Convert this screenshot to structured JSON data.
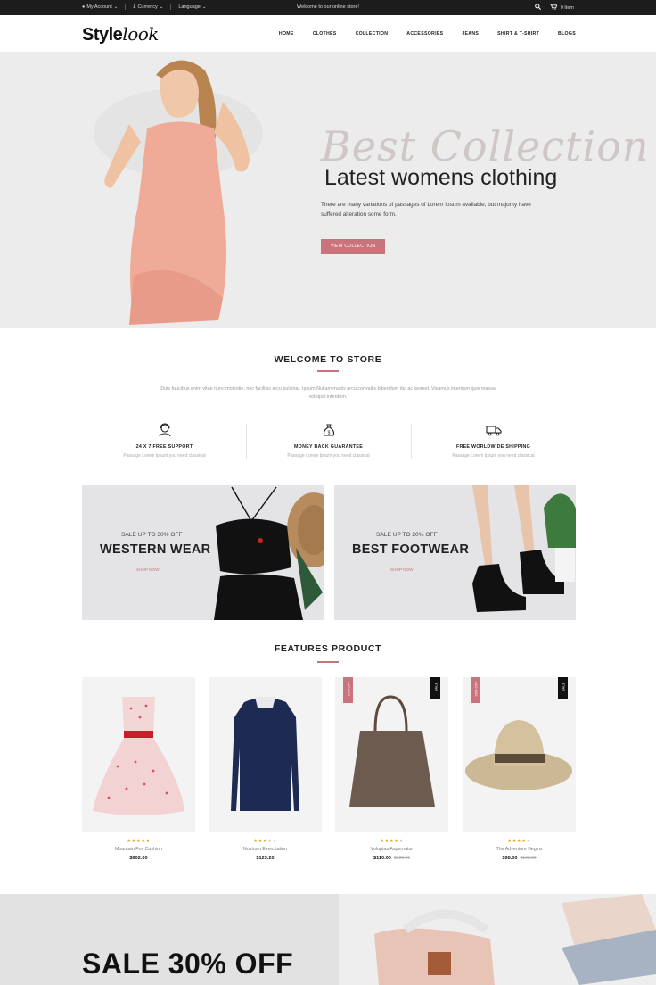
{
  "topbar": {
    "account": "My Account",
    "currency": "Currency",
    "language": "Language",
    "welcome": "Welcome to our online store!",
    "cart": "0 Item"
  },
  "header": {
    "logo_part1": "Style",
    "logo_part2": "look",
    "nav": [
      "HOME",
      "CLOTHES",
      "COLLECTION",
      "ACCESSORIES",
      "JEANS",
      "SHIRT & T-SHIRT",
      "BLOGS"
    ]
  },
  "hero": {
    "script_title": "Best Collection",
    "title": "Latest womens clothing",
    "description": "There are many variations of passages of Lorem Ipsum available, but majority have suffered alteration some form.",
    "button": "VIEW COLLECTION"
  },
  "welcome": {
    "title": "WELCOME TO STORE",
    "text": "Duis faucibus enim vitae nunc molestie, nec facilisis arcu pulvinar. Ipsum Nullam mattis arcu convallis bibendum dui ac laoreet. Vivamus interdum quis massa volutpat interdum."
  },
  "features": [
    {
      "title": "24 X 7 FREE SUPPORT",
      "subtitle": "Passage Lorem Ipsum you need classical",
      "icon": "support-agent-icon"
    },
    {
      "title": "MONEY BACK GUARANTEE",
      "subtitle": "Passage Lorem Ipsum you need classical",
      "icon": "money-bag-icon"
    },
    {
      "title": "FREE WORLDWIDE SHIPPING",
      "subtitle": "Passage Lorem Ipsum you need classical",
      "icon": "delivery-truck-icon"
    }
  ],
  "banners": [
    {
      "sale": "SALE UP TO 30% OFF",
      "title": "WESTERN WEAR",
      "cta": "SHOP NOW"
    },
    {
      "sale": "SALE UP TO 20% OFF",
      "title": "BEST FOOTWEAR",
      "cta": "SHOP NOW"
    }
  ],
  "products_section": {
    "title": "FEATURES PRODUCT"
  },
  "products": [
    {
      "name": "Mountain Fox Cushion",
      "price": "$602.00",
      "old_price": "",
      "rating": 5,
      "tag_off": "",
      "tag_sale": ""
    },
    {
      "name": "Nostrum Exercitation",
      "price": "$123.20",
      "old_price": "",
      "rating": 3,
      "tag_off": "",
      "tag_sale": ""
    },
    {
      "name": "Voluptas Aspernatur",
      "price": "$110.00",
      "old_price": "$123.00",
      "rating": 4,
      "tag_off": "10% OFF",
      "tag_sale": "SALE"
    },
    {
      "name": "The Adventure Begins",
      "price": "$98.00",
      "old_price": "$102.00",
      "rating": 4,
      "tag_off": "20% OFF",
      "tag_sale": "SALE"
    }
  ],
  "promo": {
    "title": "SALE 30% OFF"
  },
  "colors": {
    "accent": "#c9737a",
    "topbar": "#1c1c1c",
    "star": "#e8a317"
  }
}
